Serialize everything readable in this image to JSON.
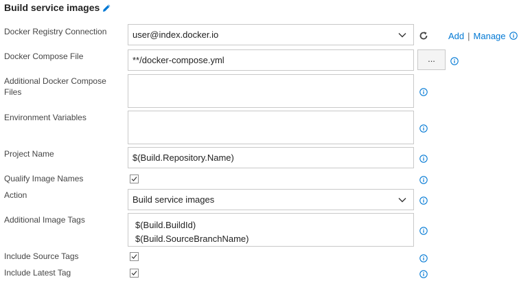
{
  "section": {
    "title": "Build service images"
  },
  "fields": {
    "registry": {
      "label": "Docker Registry Connection",
      "value": "user@index.docker.io",
      "add_label": "Add",
      "separator": "|",
      "manage_label": "Manage"
    },
    "compose_file": {
      "label": "Docker Compose File",
      "value": "**/docker-compose.yml",
      "browse_label": "..."
    },
    "additional_compose": {
      "label": "Additional Docker Compose Files",
      "value": ""
    },
    "env_vars": {
      "label": "Environment Variables",
      "value": ""
    },
    "project_name": {
      "label": "Project Name",
      "value": "$(Build.Repository.Name)"
    },
    "qualify": {
      "label": "Qualify Image Names",
      "checked": true
    },
    "action": {
      "label": "Action",
      "value": "Build service images"
    },
    "image_tags": {
      "label": "Additional Image Tags",
      "lines": [
        "$(Build.BuildId)",
        "$(Build.SourceBranchName)"
      ]
    },
    "source_tags": {
      "label": "Include Source Tags",
      "checked": true
    },
    "latest_tag": {
      "label": "Include Latest Tag",
      "checked": true
    }
  },
  "icons": {
    "edit": "pencil-icon",
    "refresh": "refresh-icon",
    "info": "info-icon",
    "dropdown": "chevron-down-icon",
    "check": "checkmark-icon"
  },
  "colors": {
    "accent": "#0078d4",
    "border": "#c8c8c8",
    "text": "#333333"
  }
}
